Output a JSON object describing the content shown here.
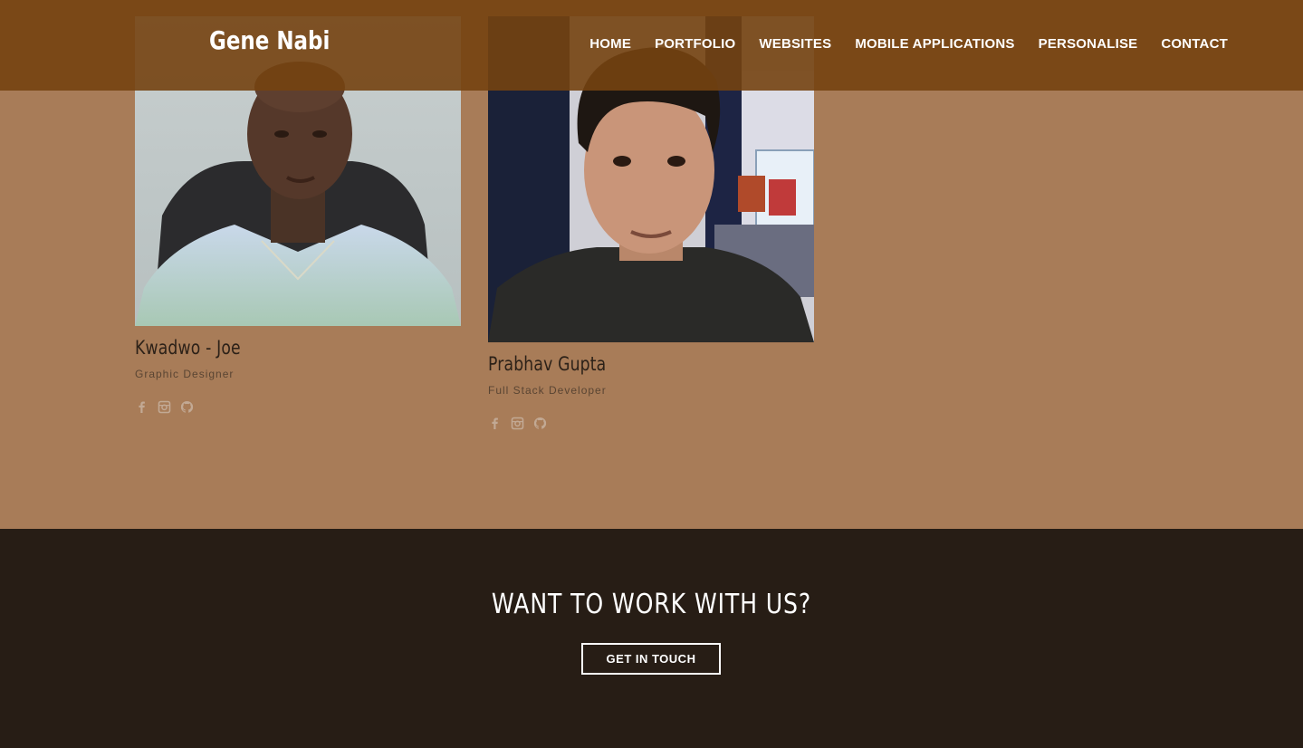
{
  "header": {
    "brand": "Gene Nabi",
    "nav": [
      "Home",
      "Portfolio",
      "Websites",
      "Mobile Applications",
      "Personalise",
      "Contact"
    ]
  },
  "team": [
    {
      "name": "Kwadwo - Joe",
      "role": "Graphic Designer",
      "social": [
        "facebook-icon",
        "instagram-icon",
        "github-icon"
      ]
    },
    {
      "name": "Prabhav Gupta",
      "role": "Full Stack Developer",
      "social": [
        "facebook-icon",
        "instagram-icon",
        "github-icon"
      ]
    }
  ],
  "cta": {
    "title": "WANT TO WORK WITH US?",
    "button": "GET IN TOUCH"
  },
  "colors": {
    "nav_bg": "#744211",
    "section_bg": "#a87c58",
    "footer_bg": "#271d15"
  }
}
